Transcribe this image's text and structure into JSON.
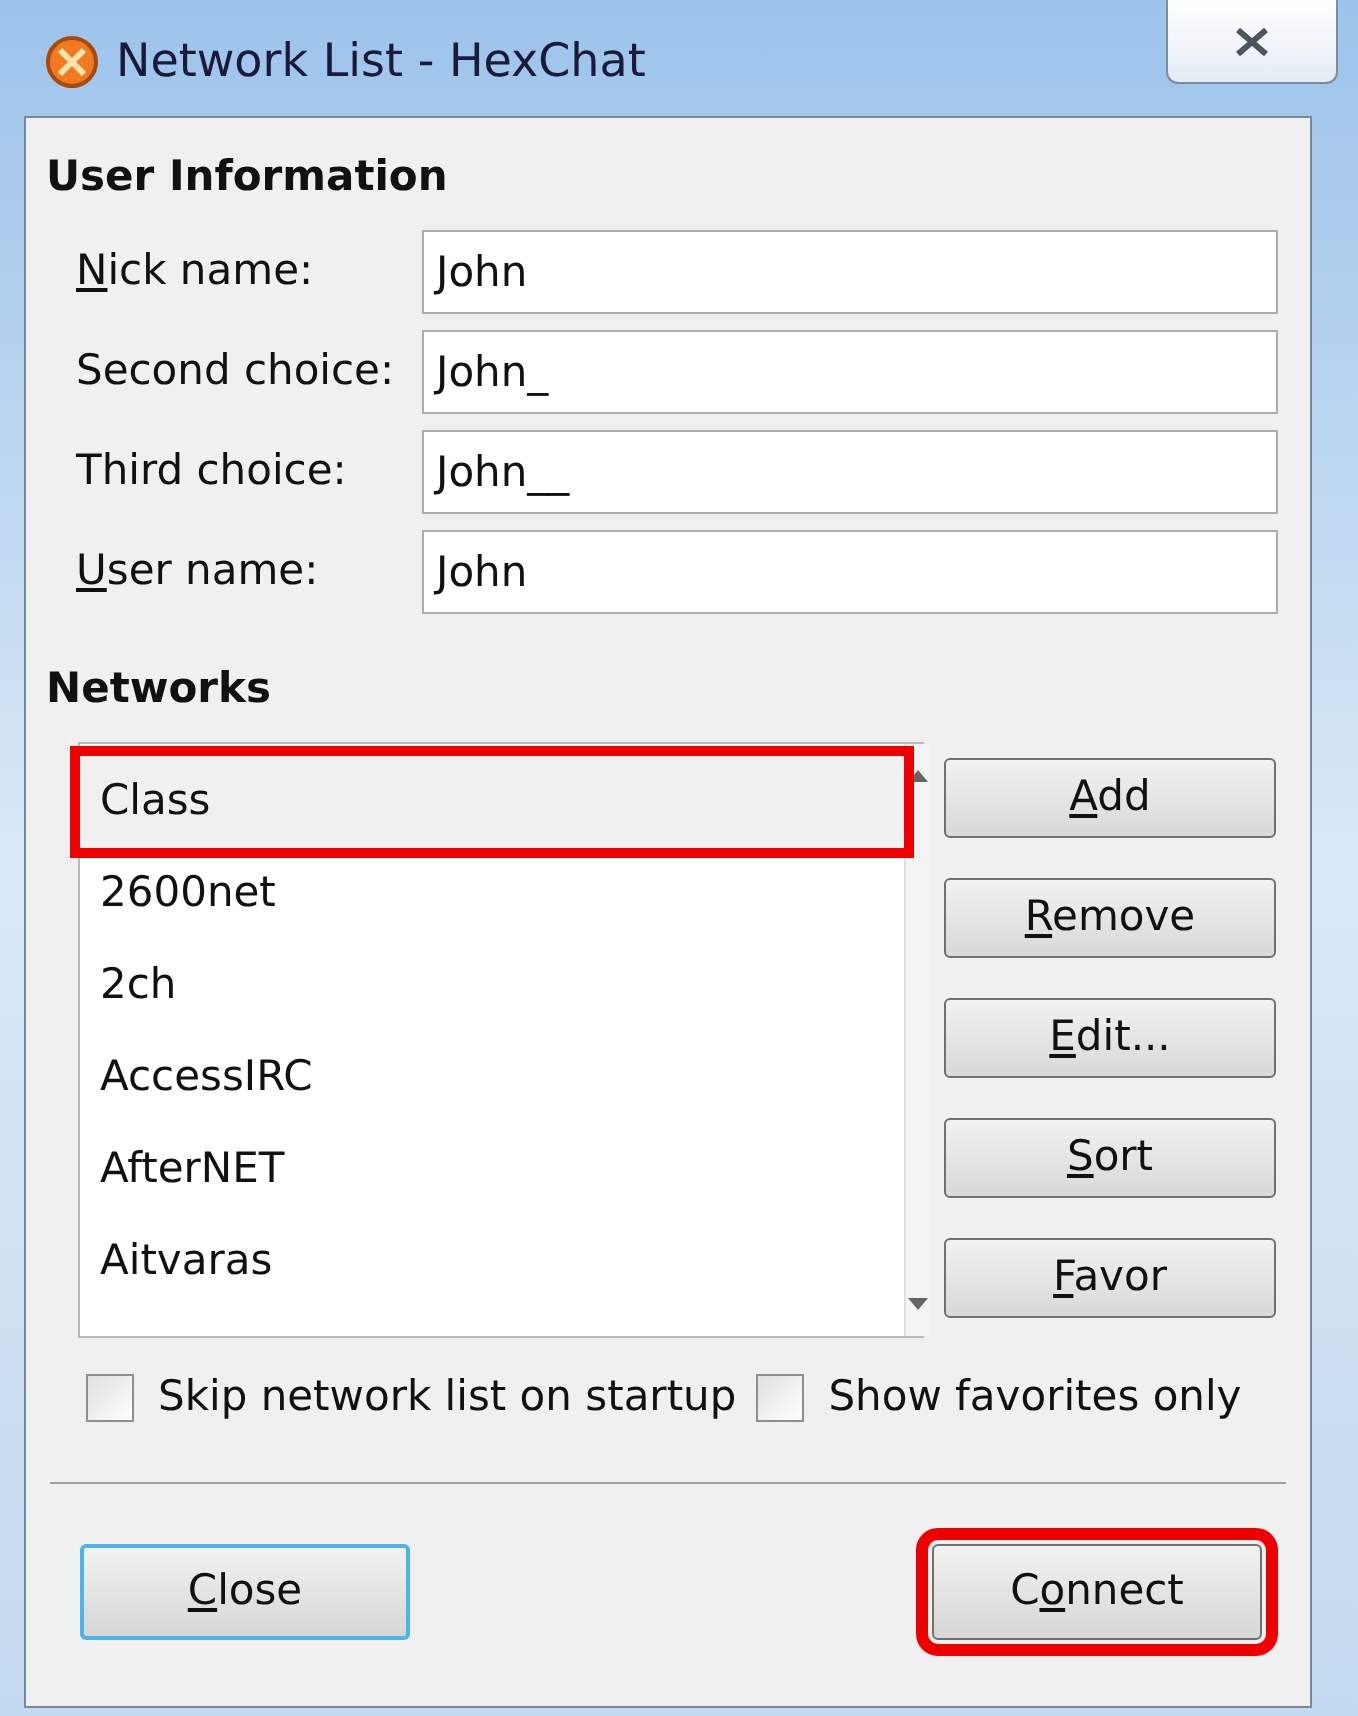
{
  "window": {
    "title": "Network List - HexChat"
  },
  "user_information": {
    "heading": "User Information",
    "fields": [
      {
        "label": {
          "key": "N",
          "rest": "ick name:"
        },
        "value": "John"
      },
      {
        "label": {
          "rest": "Second choice:"
        },
        "value": "John_"
      },
      {
        "label": {
          "rest": "Third choice:"
        },
        "value": "John__"
      },
      {
        "label": {
          "key": "U",
          "rest": "ser name:"
        },
        "value": "John"
      }
    ]
  },
  "networks": {
    "heading": "Networks",
    "items": [
      {
        "name": "Class",
        "selected": true,
        "highlighted": true
      },
      {
        "name": "2600net",
        "selected": false,
        "highlighted": false
      },
      {
        "name": "2ch",
        "selected": false,
        "highlighted": false
      },
      {
        "name": "AccessIRC",
        "selected": false,
        "highlighted": false
      },
      {
        "name": "AfterNET",
        "selected": false,
        "highlighted": false
      },
      {
        "name": "Aitvaras",
        "selected": false,
        "highlighted": false
      }
    ],
    "buttons": [
      {
        "label": {
          "key": "A",
          "rest": "dd"
        }
      },
      {
        "label": {
          "key": "R",
          "rest": "emove"
        }
      },
      {
        "label": {
          "key": "E",
          "rest": "dit..."
        }
      },
      {
        "label": {
          "key": "S",
          "rest": "ort"
        }
      },
      {
        "label": {
          "key": "F",
          "rest": "avor"
        }
      }
    ]
  },
  "options": [
    {
      "label": "Skip network list on startup",
      "checked": false
    },
    {
      "label": "Show favorites only",
      "checked": false
    }
  ],
  "footer_buttons": [
    {
      "label": {
        "key": "C",
        "rest": "lose"
      },
      "focused": true,
      "highlighted": false
    },
    {
      "label": {
        "lead": "C",
        "key": "o",
        "rest": "nnect"
      },
      "focused": false,
      "highlighted": true
    }
  ]
}
